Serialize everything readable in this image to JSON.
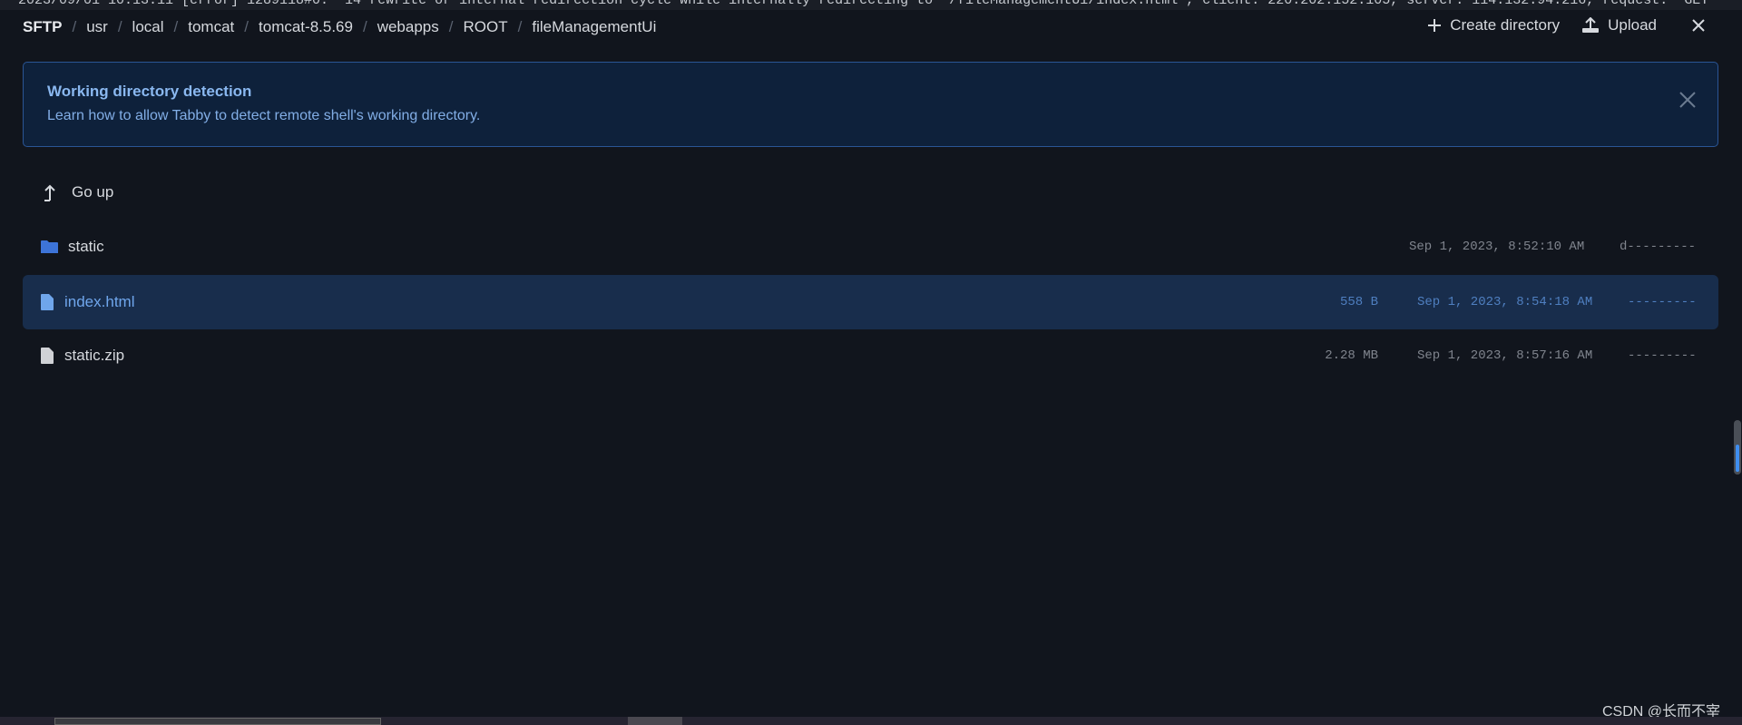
{
  "terminal_line": "2023/09/01 10:13:11 [error] 1289118#0: *14 rewrite or internal redirection cycle while internally redirecting to \"/fileManagementUi/index.html\", client: 220.202.152.105, server: 114.132.94.216, request: \"GET",
  "breadcrumb": [
    "SFTP",
    "usr",
    "local",
    "tomcat",
    "tomcat-8.5.69",
    "webapps",
    "ROOT",
    "fileManagementUi"
  ],
  "actions": {
    "create_directory": "Create directory",
    "upload": "Upload"
  },
  "banner": {
    "title": "Working directory detection",
    "description": "Learn how to allow Tabby to detect remote shell's working directory."
  },
  "go_up": "Go up",
  "files": [
    {
      "name": "static",
      "type": "folder",
      "size": "",
      "modified": "Sep 1, 2023, 8:52:10 AM",
      "mode": "d---------"
    },
    {
      "name": "index.html",
      "type": "file",
      "size": "558 B",
      "modified": "Sep 1, 2023, 8:54:18 AM",
      "mode": "---------"
    },
    {
      "name": "static.zip",
      "type": "file",
      "size": "2.28 MB",
      "modified": "Sep 1, 2023, 8:57:16 AM",
      "mode": "---------"
    }
  ],
  "watermark": "CSDN @长而不宰",
  "colors": {
    "background": "#11151d",
    "accent": "#3f8ef0",
    "selected_row": "#182d4c",
    "banner": "#0e213b"
  }
}
